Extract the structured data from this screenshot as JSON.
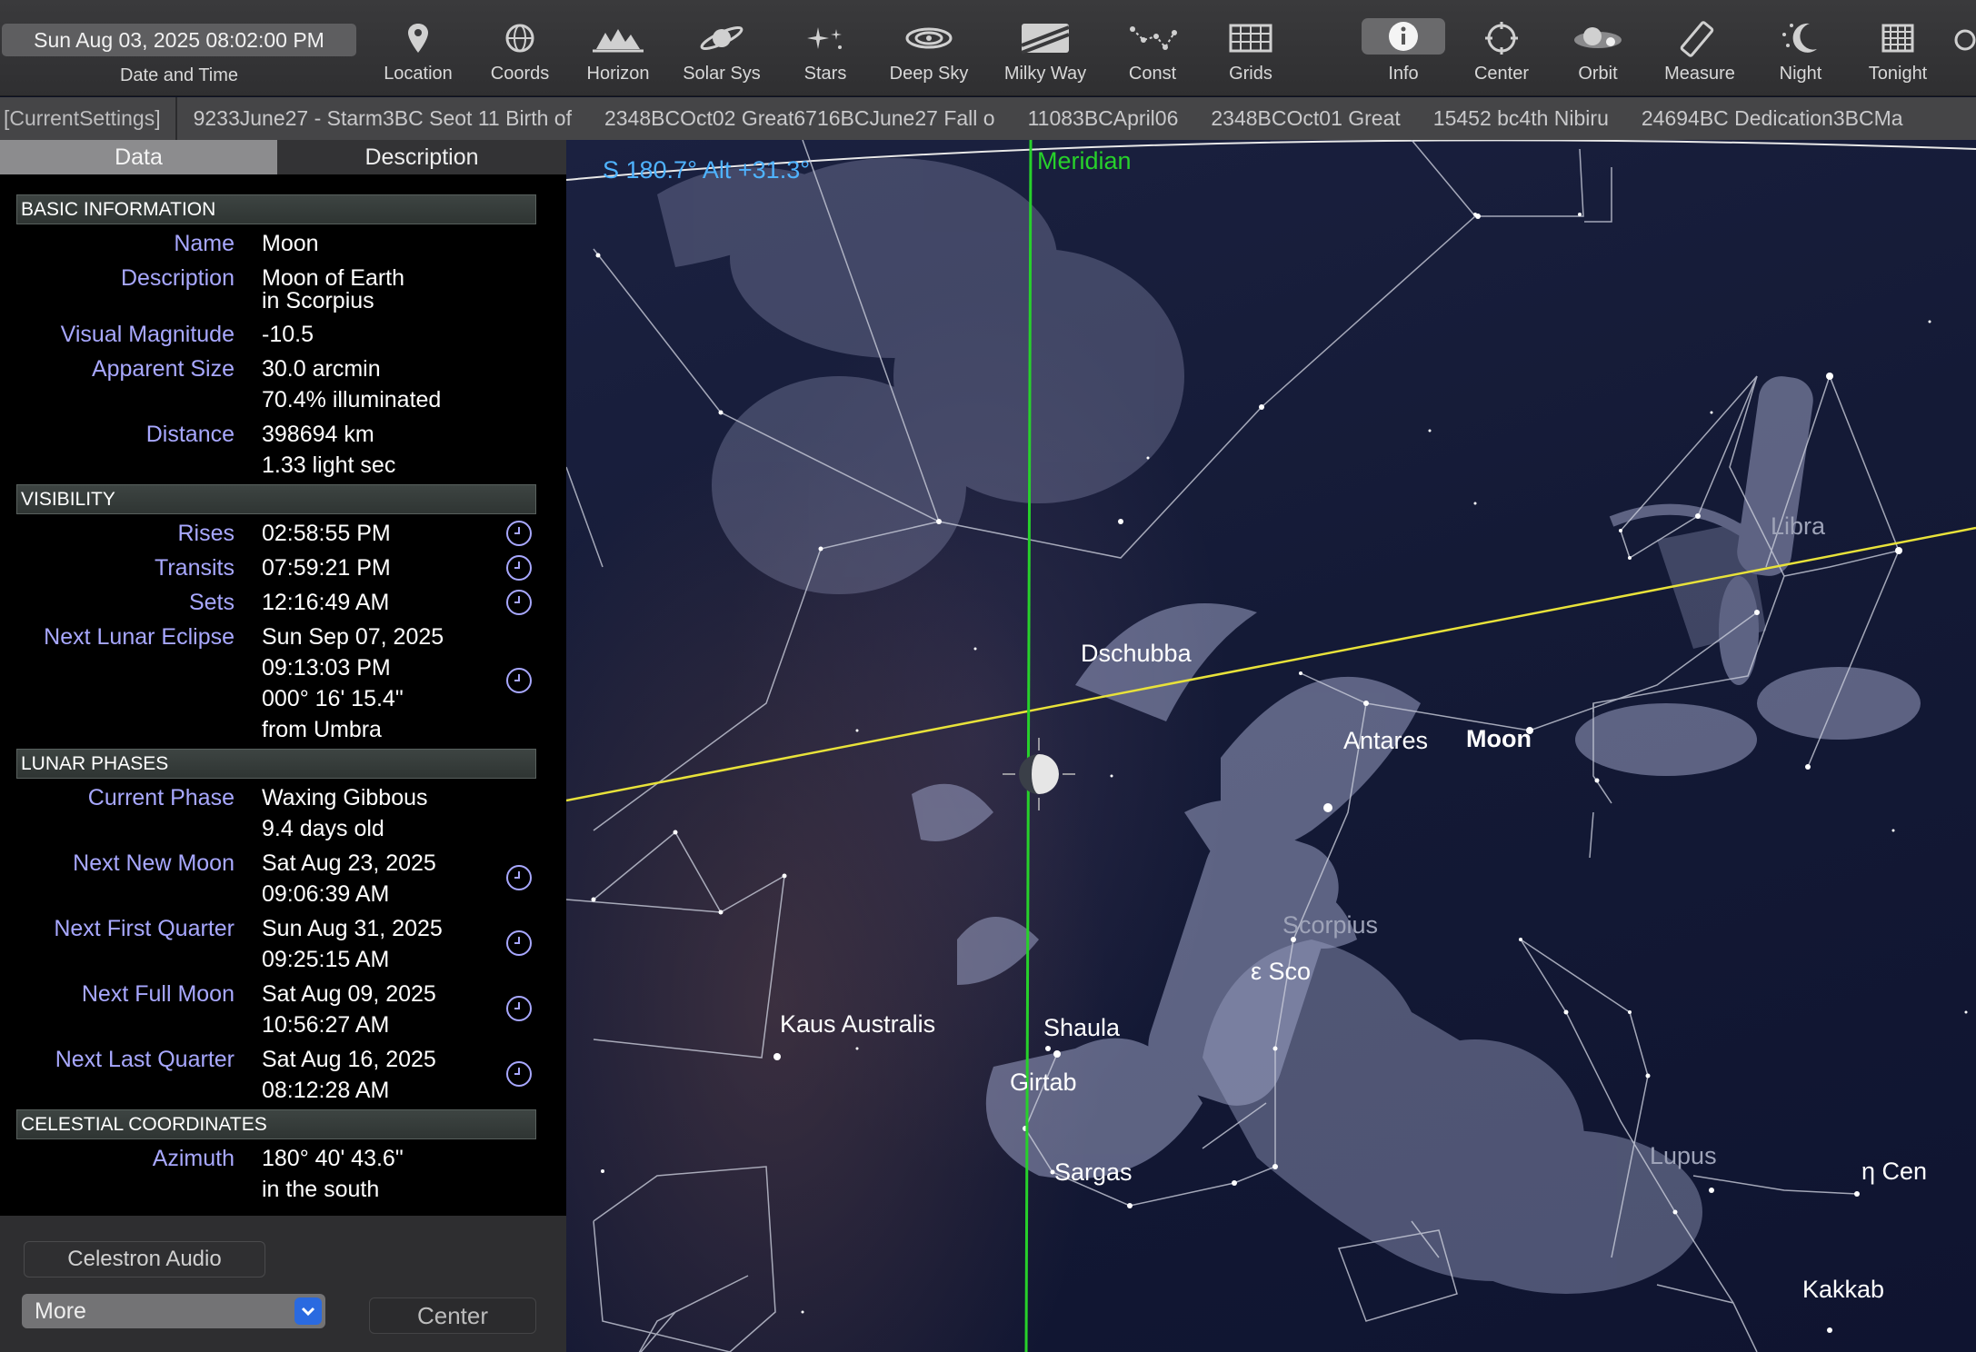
{
  "toolbar": {
    "datetime": "Sun Aug 03, 2025  08:02:00 PM",
    "datetime_caption": "Date and Time",
    "items": [
      {
        "label": "Location",
        "icon": "location-pin-icon"
      },
      {
        "label": "Coords",
        "icon": "coords-icon"
      },
      {
        "label": "Horizon",
        "icon": "horizon-icon"
      },
      {
        "label": "Solar Sys",
        "icon": "saturn-icon"
      },
      {
        "label": "Stars",
        "icon": "stars-icon"
      },
      {
        "label": "Deep Sky",
        "icon": "galaxy-icon"
      },
      {
        "label": "Milky Way",
        "icon": "milky-way-icon"
      },
      {
        "label": "Const",
        "icon": "constellation-icon"
      },
      {
        "label": "Grids",
        "icon": "grid-icon"
      },
      {
        "label": "Info",
        "icon": "info-icon",
        "active": true
      },
      {
        "label": "Center",
        "icon": "center-target-icon"
      },
      {
        "label": "Orbit",
        "icon": "orbit-icon"
      },
      {
        "label": "Measure",
        "icon": "ruler-icon"
      },
      {
        "label": "Night",
        "icon": "moon-night-icon"
      },
      {
        "label": "Tonight",
        "icon": "calendar-icon"
      }
    ]
  },
  "ticker": {
    "current": "[CurrentSettings]",
    "events": [
      "9233June27 - Starm3BC Seot 11 Birth of",
      "2348BCOct02 Great6716BCJune27 Fall o",
      "11083BCApril06",
      "2348BCOct01 Great",
      "15452 bc4th Nibiru",
      "24694BC Dedication3BCMa"
    ]
  },
  "panel": {
    "tabs": {
      "data": "Data",
      "description": "Description"
    },
    "sections": {
      "basic": "BASIC INFORMATION",
      "visibility": "VISIBILITY",
      "phases": "LUNAR PHASES",
      "coords": "CELESTIAL COORDINATES"
    },
    "basic": {
      "name_label": "Name",
      "name": "Moon",
      "desc_label": "Description",
      "desc1": "Moon of Earth",
      "desc2": "in Scorpius",
      "mag_label": "Visual Magnitude",
      "mag": "-10.5",
      "size_label": "Apparent Size",
      "size1": "30.0 arcmin",
      "size2": "70.4% illuminated",
      "dist_label": "Distance",
      "dist1": "398694 km",
      "dist2": "1.33 light sec"
    },
    "visibility": {
      "rises_label": "Rises",
      "rises": "02:58:55 PM",
      "transits_label": "Transits",
      "transits": "07:59:21 PM",
      "sets_label": "Sets",
      "sets": "12:16:49 AM",
      "eclipse_label": "Next Lunar Eclipse",
      "eclipse1": "Sun Sep 07, 2025",
      "eclipse2": "09:13:03 PM",
      "eclipse3": "000° 16' 15.4\"",
      "eclipse4": "from Umbra"
    },
    "phases": {
      "current_label": "Current Phase",
      "current1": "Waxing Gibbous",
      "current2": "9.4 days old",
      "new_label": "Next New Moon",
      "new1": "Sat Aug 23, 2025",
      "new2": "09:06:39 AM",
      "first_label": "Next First Quarter",
      "first1": "Sun Aug 31, 2025",
      "first2": "09:25:15 AM",
      "full_label": "Next Full Moon",
      "full1": "Sat Aug 09, 2025",
      "full2": "10:56:27 AM",
      "last_label": "Next Last Quarter",
      "last1": "Sat Aug 16, 2025",
      "last2": "08:12:28 AM"
    },
    "coords": {
      "az_label": "Azimuth",
      "az1": "180° 40' 43.6\"",
      "az2": "in the south"
    },
    "buttons": {
      "audio": "Celestron Audio",
      "more": "More",
      "center": "Center"
    }
  },
  "sky": {
    "readout": "S 180.7° Alt +31.3°",
    "meridian": "Meridian",
    "stars": {
      "dschubba": "Dschubba",
      "antares": "Antares",
      "moon": "Moon",
      "eps_sco": "ε Sco",
      "kaus": "Kaus Australis",
      "shaula": "Shaula",
      "girtab": "Girtab",
      "sargas": "Sargas",
      "eta_cen": "η Cen",
      "kakkab": "Kakkab"
    },
    "constellations": {
      "libra": "Libra",
      "scorpius": "Scorpius",
      "lupus": "Lupus"
    },
    "colors": {
      "meridian": "#27d12b",
      "ecliptic": "#e8e23a",
      "readout": "#4fb3ff"
    }
  }
}
